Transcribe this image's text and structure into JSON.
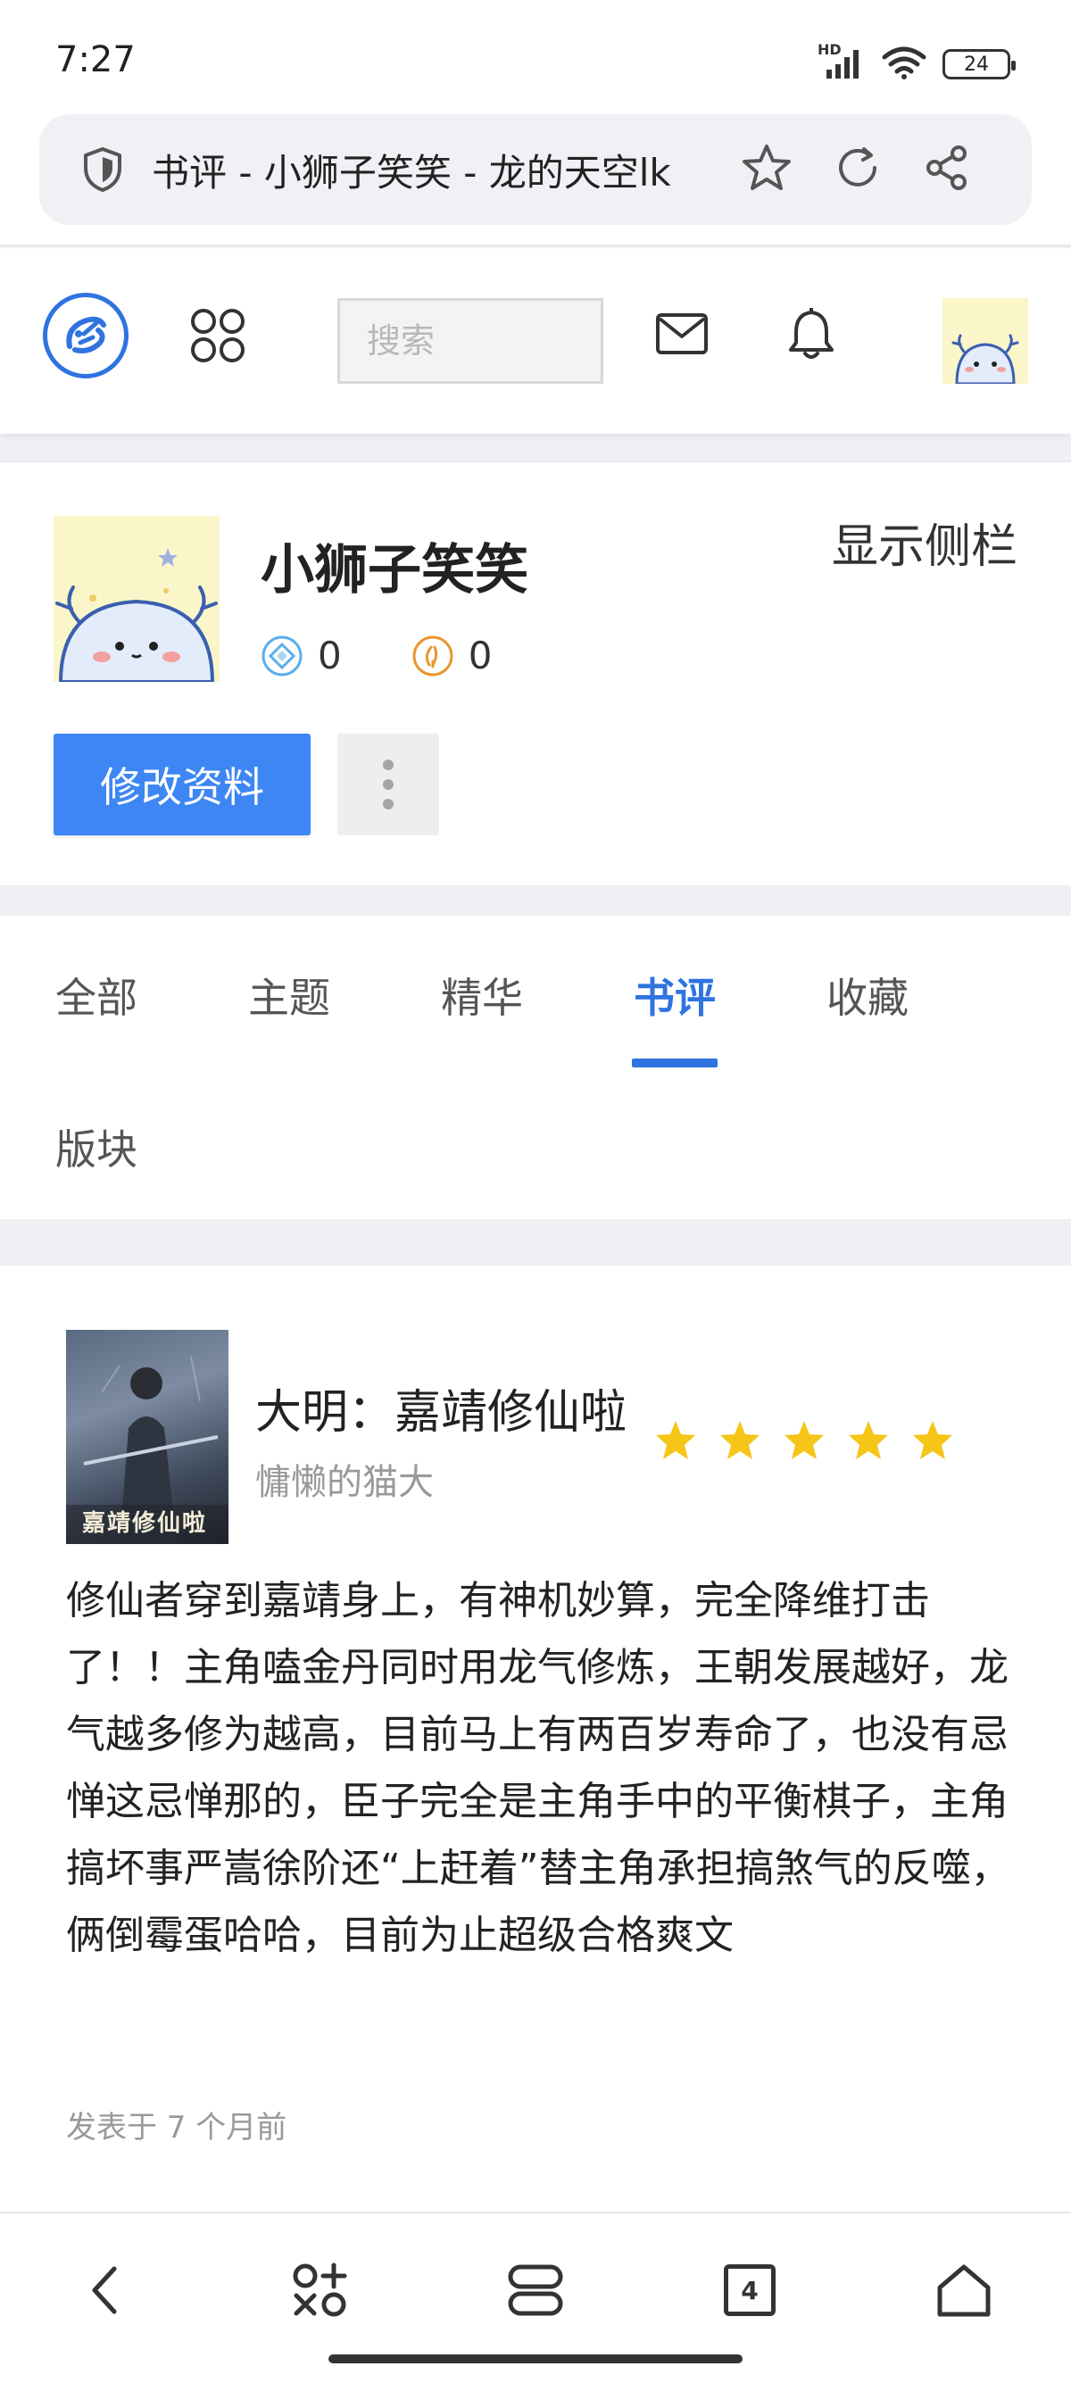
{
  "status": {
    "time": "7:27",
    "battery": "24",
    "network": "HD"
  },
  "browser": {
    "url_title": "书评 - 小狮子笑笑 - 龙的天空lk"
  },
  "header": {
    "search_placeholder": "搜索"
  },
  "profile": {
    "username": "小狮子笑笑",
    "stat_a": "0",
    "stat_b": "0",
    "sidebar_toggle": "显示侧栏",
    "edit_button": "修改资料"
  },
  "tabs": [
    {
      "label": "全部"
    },
    {
      "label": "主题"
    },
    {
      "label": "精华"
    },
    {
      "label": "书评",
      "active": true
    },
    {
      "label": "收藏"
    },
    {
      "label": "版块"
    }
  ],
  "review": {
    "book_title": "大明：嘉靖修仙啦",
    "author": "慵懒的猫大",
    "rating": 5,
    "cover_text": "嘉靖修仙啦",
    "body": "修仙者穿到嘉靖身上，有神机妙算，完全降维打击了！！主角嗑金丹同时用龙气修炼，王朝发展越好，龙气越多修为越高，目前马上有两百岁寿命了，也没有忌惮这忌惮那的，臣子完全是主角手中的平衡棋子，主角搞坏事严嵩徐阶还“上赶着”替主角承担搞煞气的反噬，俩倒霉蛋哈哈，目前为止超级合格爽文",
    "posted": "发表于 7 个月前"
  },
  "bottom_nav": {
    "tab_count": "4"
  },
  "colors": {
    "accent": "#2f73e0",
    "button": "#3d86f4",
    "star": "#f5c518"
  }
}
